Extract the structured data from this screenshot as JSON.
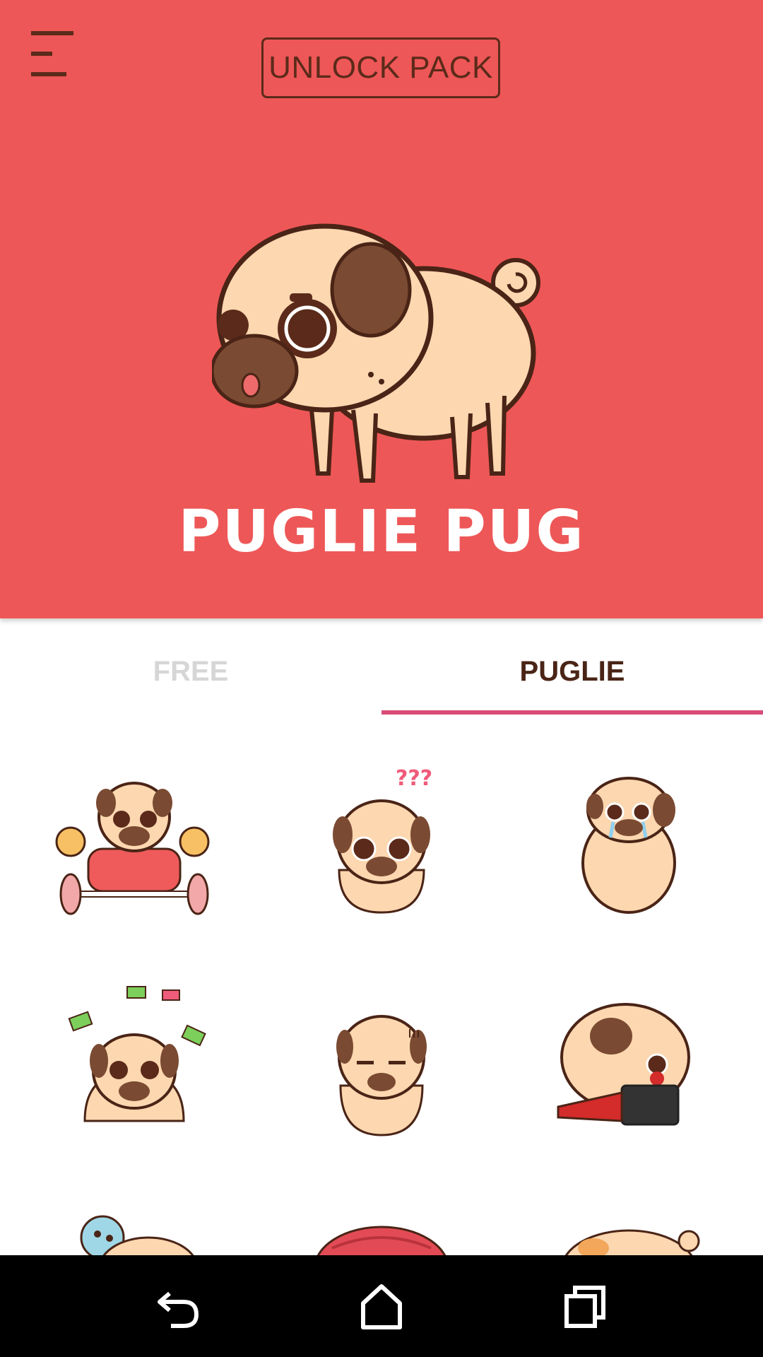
{
  "header": {
    "background": "#EE5757",
    "menu_icon": "hamburger-menu-icon",
    "unlock_label": "UNLOCK PACK",
    "title": "PUGLIE PUG",
    "hero_image": "puglie-pug-hero"
  },
  "tabs": [
    {
      "label": "FREE",
      "selected": false
    },
    {
      "label": "PUGLIE",
      "selected": true
    }
  ],
  "accent": "#D94C78",
  "stickers": [
    {
      "name": "weightlifting-pug-sticker"
    },
    {
      "name": "confused-pug-sticker"
    },
    {
      "name": "crying-pug-sticker"
    },
    {
      "name": "money-rain-pug-sticker"
    },
    {
      "name": "annoyed-pug-sticker"
    },
    {
      "name": "lipstick-pug-sticker"
    },
    {
      "name": "pug-with-ball-sticker"
    },
    {
      "name": "pug-with-red-cushion-sticker"
    },
    {
      "name": "sleeping-pug-sticker"
    }
  ],
  "navbar": {
    "back_icon": "back-icon",
    "home_icon": "home-icon",
    "recents_icon": "recents-icon"
  }
}
